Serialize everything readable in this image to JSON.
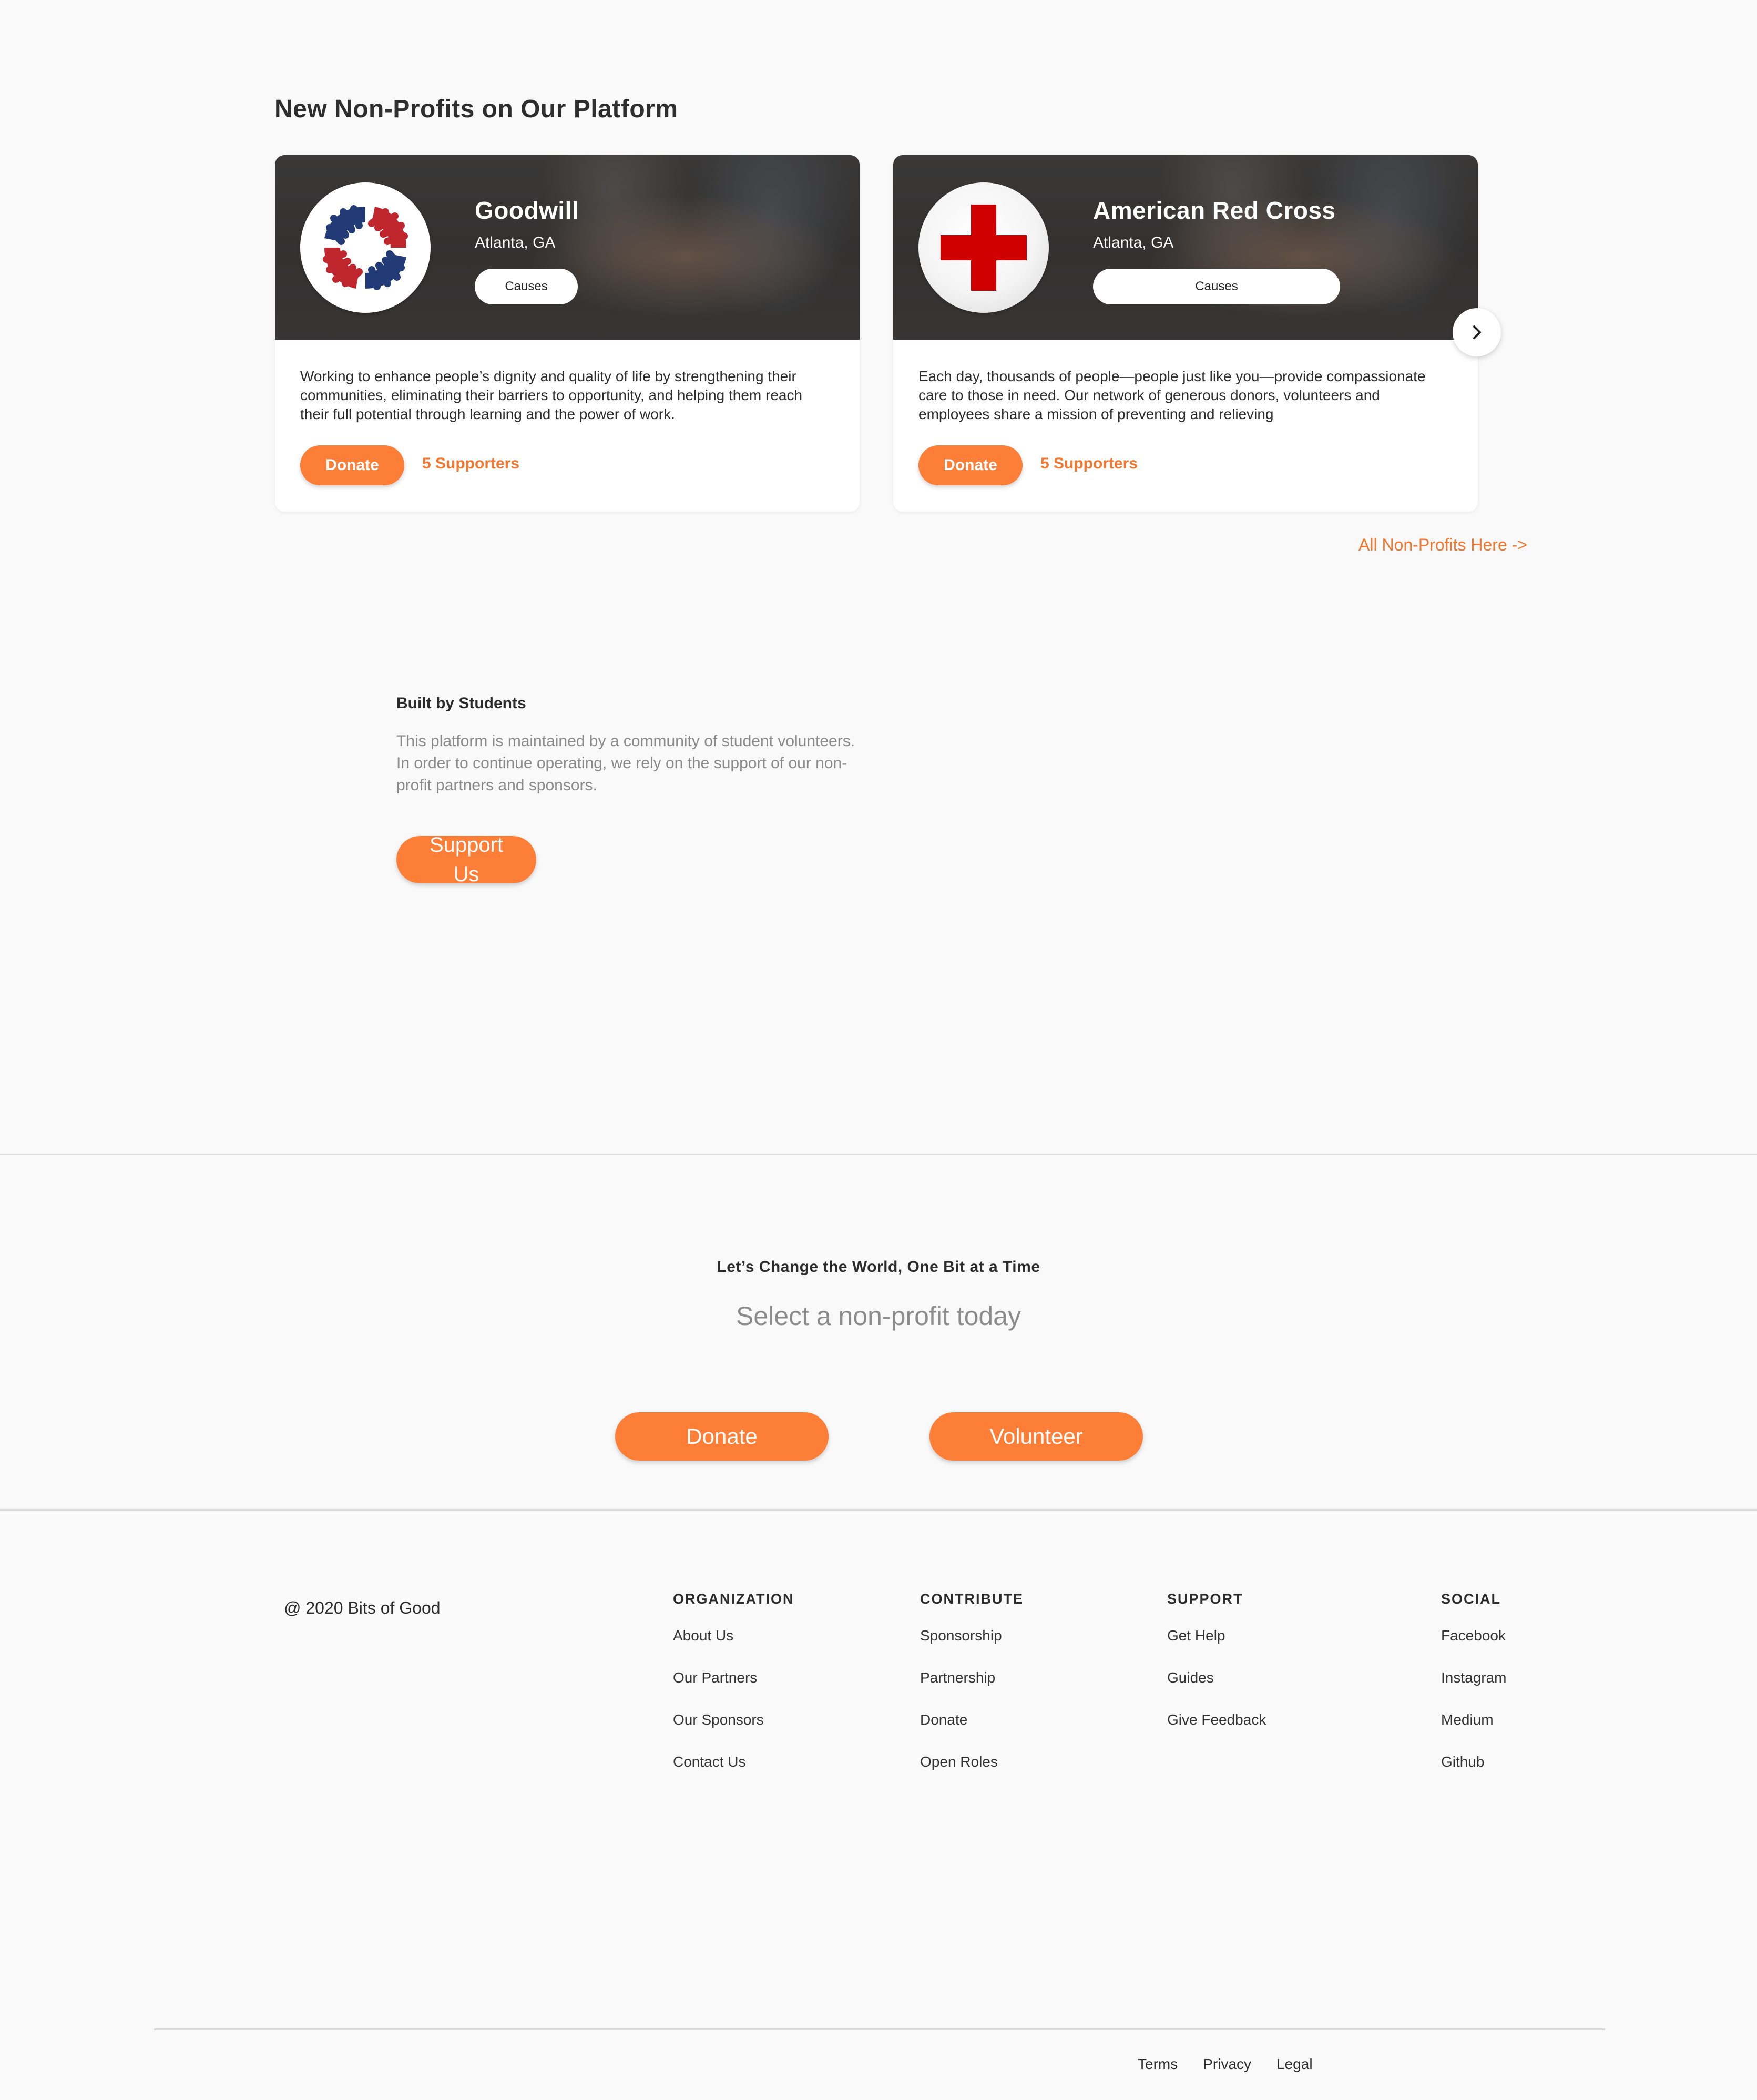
{
  "section_title": "New Non-Profits on Our Platform",
  "cards": [
    {
      "name": "Goodwill",
      "location": "Atlanta, GA",
      "causes_label": "Causes",
      "description": "Working to enhance people’s dignity and quality of life by strengthening their communities, eliminating their barriers to opportunity, and helping them reach their full potential through learning and the power of work.",
      "donate_label": "Donate",
      "supporters": "5 Supporters",
      "logo_icon": "hands-logo-icon"
    },
    {
      "name": "American Red Cross",
      "location": "Atlanta, GA",
      "causes_label": "Causes",
      "description": "Each day, thousands of people—people just like you—provide compassionate care to those in need. Our network of generous donors, volunteers and employees share a mission of preventing and relieving",
      "donate_label": "Donate",
      "supporters": "5 Supporters",
      "logo_icon": "red-cross-logo-icon"
    }
  ],
  "carousel_next_icon": "chevron-right-icon",
  "all_nonprofits_link": "All Non-Profits Here ->",
  "built": {
    "title": "Built by Students",
    "text": "This platform is maintained by a community of student volunteers. In order to continue operating, we rely on the support of our non-profit partners and sponsors.",
    "button": "Support Us"
  },
  "cta": {
    "title": "Let’s Change the World, One Bit at a Time",
    "subtitle": "Select a non-profit today",
    "donate": "Donate",
    "volunteer": "Volunteer"
  },
  "footer": {
    "copyright": "@ 2020 Bits of Good",
    "columns": [
      {
        "heading": "ORGANIZATION",
        "items": [
          "About Us",
          "Our Partners",
          "Our Sponsors",
          "Contact Us"
        ]
      },
      {
        "heading": "CONTRIBUTE",
        "items": [
          "Sponsorship",
          "Partnership",
          "Donate",
          "Open Roles"
        ]
      },
      {
        "heading": "SUPPORT",
        "items": [
          "Get Help",
          "Guides",
          "Give Feedback"
        ]
      },
      {
        "heading": "SOCIAL",
        "items": [
          "Facebook",
          "Instagram",
          "Medium",
          "Github"
        ]
      }
    ],
    "legal": [
      "Terms",
      "Privacy",
      "Legal"
    ]
  },
  "colors": {
    "accent": "#fc7e37",
    "accent_text": "#f2772f",
    "background": "#f9f9f9",
    "goodwill_red": "#c0262d",
    "goodwill_blue": "#223b76",
    "red_cross": "#d00000"
  }
}
